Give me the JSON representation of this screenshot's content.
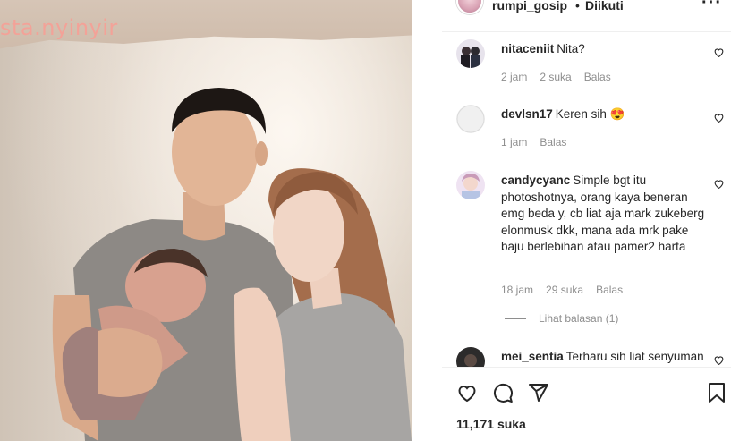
{
  "media": {
    "watermark": "sta.nyinyir"
  },
  "post": {
    "username": "rumpi_gosip",
    "separator": "•",
    "follow_label": "Diikuti",
    "more_label": "···"
  },
  "comments": [
    {
      "user": "nitaceniit",
      "text": "Nita?",
      "time": "2 jam",
      "likes": "2 suka",
      "reply": "Balas"
    },
    {
      "user": "devlsn17",
      "text": "Keren sih 😍",
      "time": "1 jam",
      "likes": "",
      "reply": "Balas"
    },
    {
      "user": "candycyanc",
      "text": "Simple bgt itu photoshotnya, orang kaya beneran emg beda y, cb liat aja mark zukeberg elonmusk dkk, mana ada mrk pake baju berlebihan atau pamer2 harta",
      "time": "18 jam",
      "likes": "29 suka",
      "reply": "Balas"
    },
    {
      "user": "mei_sentia",
      "text": "Terharu sih liat senyuman",
      "time": "",
      "likes": "",
      "reply": ""
    }
  ],
  "replies_label": "Lihat balasan (1)",
  "likes_count": "11,171 suka",
  "icons": {
    "like": "heart-icon",
    "comment": "comment-icon",
    "share": "share-icon",
    "save": "bookmark-icon",
    "comment_like": "heart-outline-icon"
  },
  "colors": {
    "text": "#262626",
    "muted": "#8e8e8e",
    "border": "#efefef",
    "watermark": "#f5a096"
  }
}
